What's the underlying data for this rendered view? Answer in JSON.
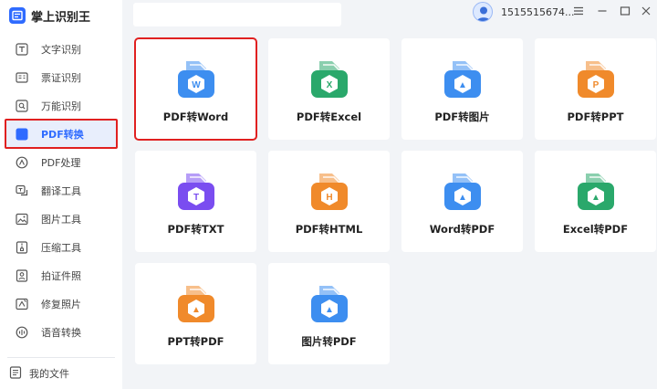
{
  "app": {
    "name": "掌上识别王",
    "username": "1515515674..."
  },
  "sidebar": {
    "items": [
      {
        "label": "文字识别",
        "icon": "text-recognition-icon"
      },
      {
        "label": "票证识别",
        "icon": "ticket-recognition-icon"
      },
      {
        "label": "万能识别",
        "icon": "universal-recognition-icon"
      },
      {
        "label": "PDF转换",
        "icon": "pdf-convert-icon",
        "active": true
      },
      {
        "label": "PDF处理",
        "icon": "pdf-process-icon"
      },
      {
        "label": "翻译工具",
        "icon": "translate-icon"
      },
      {
        "label": "图片工具",
        "icon": "image-tools-icon"
      },
      {
        "label": "压缩工具",
        "icon": "compress-icon"
      },
      {
        "label": "拍证件照",
        "icon": "id-photo-icon"
      },
      {
        "label": "修复照片",
        "icon": "repair-photo-icon"
      },
      {
        "label": "语音转换",
        "icon": "voice-convert-icon"
      }
    ],
    "my_files": "我的文件"
  },
  "window_controls": [
    "menu",
    "minimize",
    "maximize",
    "close"
  ],
  "cards": [
    {
      "label": "PDF转Word",
      "letter": "W",
      "color": "#3d8ef0",
      "icon": "pdf-to-word-icon",
      "selected": true
    },
    {
      "label": "PDF转Excel",
      "letter": "X",
      "color": "#2aa86b",
      "icon": "pdf-to-excel-icon"
    },
    {
      "label": "PDF转图片",
      "letter": "▲",
      "color": "#3d8ef0",
      "icon": "pdf-to-image-icon"
    },
    {
      "label": "PDF转PPT",
      "letter": "P",
      "color": "#f08a2b",
      "icon": "pdf-to-ppt-icon"
    },
    {
      "label": "PDF转TXT",
      "letter": "T",
      "color": "#7a4df0",
      "icon": "pdf-to-txt-icon"
    },
    {
      "label": "PDF转HTML",
      "letter": "H",
      "color": "#f08a2b",
      "icon": "pdf-to-html-icon"
    },
    {
      "label": "Word转PDF",
      "letter": "▲",
      "color": "#3d8ef0",
      "icon": "word-to-pdf-icon"
    },
    {
      "label": "Excel转PDF",
      "letter": "▲",
      "color": "#2aa86b",
      "icon": "excel-to-pdf-icon"
    },
    {
      "label": "PPT转PDF",
      "letter": "▲",
      "color": "#f08a2b",
      "icon": "ppt-to-pdf-icon"
    },
    {
      "label": "图片转PDF",
      "letter": "▲",
      "color": "#3d8ef0",
      "icon": "image-to-pdf-icon"
    }
  ],
  "colors": {
    "accent": "#2f6bff",
    "highlight": "#e02020",
    "background": "#f2f4f7"
  }
}
